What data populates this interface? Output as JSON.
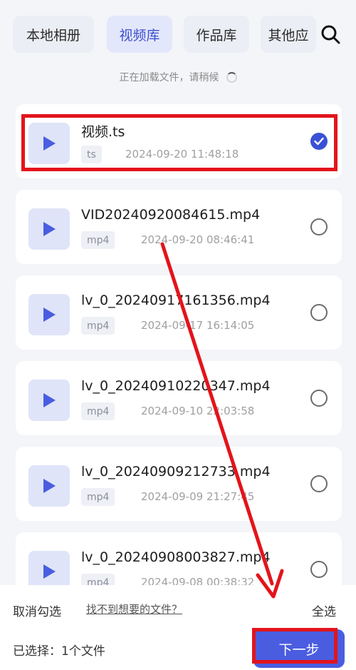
{
  "tabs": [
    {
      "label": "本地相册",
      "active": false
    },
    {
      "label": "视频库",
      "active": true
    },
    {
      "label": "作品库",
      "active": false
    },
    {
      "label": "其他应",
      "active": false
    }
  ],
  "icons": {
    "search": "search-icon",
    "play": "play-icon",
    "check": "check-icon"
  },
  "loading": {
    "text": "正在加载文件，请稍候"
  },
  "files": [
    {
      "name": "视频.ts",
      "ext": "ts",
      "date": "2024-09-20 11:48:18",
      "selected": true
    },
    {
      "name": "VID20240920084615.mp4",
      "ext": "mp4",
      "date": "2024-09-20 08:46:41",
      "selected": false
    },
    {
      "name": "lv_0_20240917161356.mp4",
      "ext": "mp4",
      "date": "2024-09-17 16:14:05",
      "selected": false
    },
    {
      "name": "lv_0_20240910220347.mp4",
      "ext": "mp4",
      "date": "2024-09-10 22:03:58",
      "selected": false
    },
    {
      "name": "lv_0_20240909212733.mp4",
      "ext": "mp4",
      "date": "2024-09-09 21:27:45",
      "selected": false
    },
    {
      "name": "lv_0_20240908003827.mp4",
      "ext": "mp4",
      "date": "2024-09-08 00:38:32",
      "selected": false
    }
  ],
  "footer": {
    "cancel_label": "取消勾选",
    "help_link": "找不到想要的文件？",
    "select_all_label": "全选",
    "selected_label": "已选择：",
    "selected_count": "1个文件",
    "next_label": "下一步"
  },
  "colors": {
    "accent": "#3a51d6",
    "annotation": "#e3141b"
  }
}
